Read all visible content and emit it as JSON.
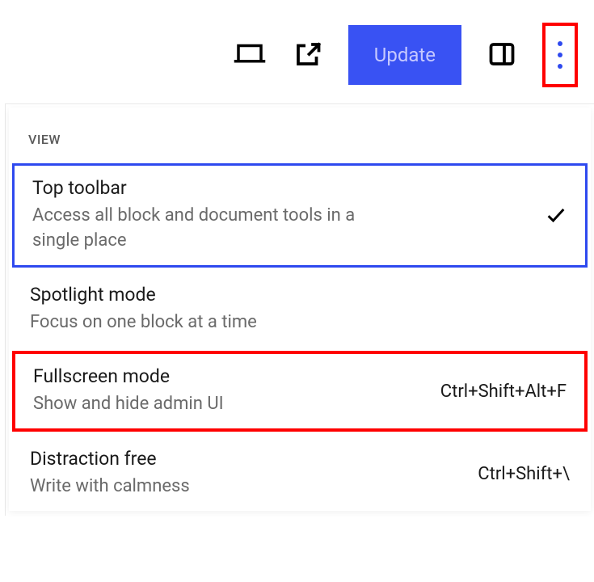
{
  "toolbar": {
    "update_label": "Update"
  },
  "menu": {
    "section_label": "VIEW",
    "items": [
      {
        "title": "Top toolbar",
        "description": "Access all block and document tools in a single place",
        "checked": true,
        "shortcut": ""
      },
      {
        "title": "Spotlight mode",
        "description": "Focus on one block at a time",
        "checked": false,
        "shortcut": ""
      },
      {
        "title": "Fullscreen mode",
        "description": "Show and hide admin UI",
        "checked": false,
        "shortcut": "Ctrl+Shift+Alt+F"
      },
      {
        "title": "Distraction free",
        "description": "Write with calmness",
        "checked": false,
        "shortcut": "Ctrl+Shift+\\"
      }
    ]
  }
}
